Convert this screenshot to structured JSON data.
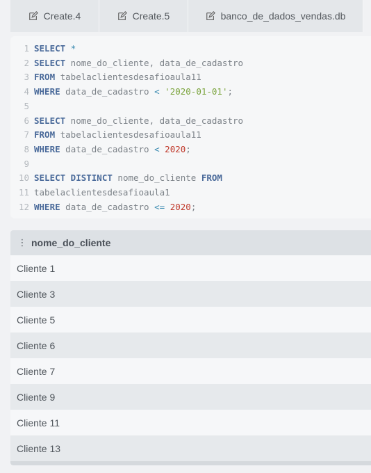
{
  "tabs": [
    {
      "label": "Create.4",
      "icon": "edit-icon"
    },
    {
      "label": "Create.5",
      "icon": "edit-icon"
    },
    {
      "label": "banco_de_dados_vendas.db",
      "icon": "edit-icon"
    }
  ],
  "editor": {
    "lines": [
      {
        "n": "1",
        "tokens": [
          [
            "kw",
            "SELECT"
          ],
          [
            "punc",
            " "
          ],
          [
            "op",
            "*"
          ]
        ]
      },
      {
        "n": "2",
        "tokens": [
          [
            "kw",
            "SELECT"
          ],
          [
            "id",
            " nome_do_cliente, data_de_cadastro"
          ]
        ]
      },
      {
        "n": "3",
        "tokens": [
          [
            "kw",
            "FROM"
          ],
          [
            "id",
            " tabelaclientesdesafioaula11"
          ]
        ]
      },
      {
        "n": "4",
        "tokens": [
          [
            "kw",
            "WHERE"
          ],
          [
            "id",
            " data_de_cadastro "
          ],
          [
            "op",
            "<"
          ],
          [
            "punc",
            " "
          ],
          [
            "str",
            "'2020-01-01'"
          ],
          [
            "punc",
            ";"
          ]
        ]
      },
      {
        "n": "5",
        "tokens": []
      },
      {
        "n": "6",
        "tokens": [
          [
            "kw",
            "SELECT"
          ],
          [
            "id",
            " nome_do_cliente, data_de_cadastro"
          ]
        ]
      },
      {
        "n": "7",
        "tokens": [
          [
            "kw",
            "FROM"
          ],
          [
            "id",
            " tabelaclientesdesafioaula11"
          ]
        ]
      },
      {
        "n": "8",
        "tokens": [
          [
            "kw",
            "WHERE"
          ],
          [
            "id",
            " data_de_cadastro "
          ],
          [
            "op",
            "<"
          ],
          [
            "punc",
            " "
          ],
          [
            "num",
            "2020"
          ],
          [
            "punc",
            ";"
          ]
        ]
      },
      {
        "n": "9",
        "tokens": []
      },
      {
        "n": "10",
        "tokens": [
          [
            "kw",
            "SELECT DISTINCT"
          ],
          [
            "id",
            " nome_do_cliente "
          ],
          [
            "kw",
            "FROM"
          ]
        ]
      },
      {
        "n": "11",
        "tokens": [
          [
            "id",
            "tabelaclientesdesafioaula1"
          ]
        ]
      },
      {
        "n": "12",
        "tokens": [
          [
            "kw",
            "WHERE"
          ],
          [
            "id",
            " data_de_cadastro "
          ],
          [
            "op",
            "<="
          ],
          [
            "punc",
            " "
          ],
          [
            "num",
            "2020"
          ],
          [
            "punc",
            ";"
          ]
        ]
      }
    ]
  },
  "results": {
    "column": "nome_do_cliente",
    "rows": [
      "Cliente 1",
      "Cliente 3",
      "Cliente 5",
      "Cliente 6",
      "Cliente 7",
      "Cliente 9",
      "Cliente 11",
      "Cliente 13"
    ]
  }
}
